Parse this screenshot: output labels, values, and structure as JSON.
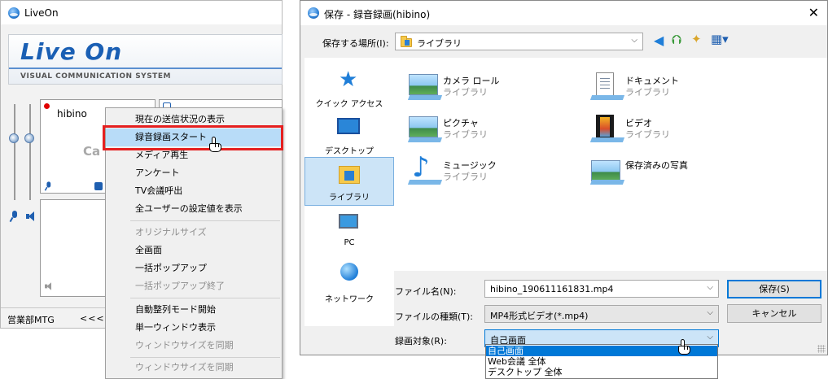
{
  "liveon": {
    "title": "LiveOn",
    "logo_text": "Live On",
    "logo_sub": "VISUAL COMMUNICATION SYSTEM",
    "panel_user": "hibino",
    "panel_cam_text": "Ca",
    "status_left": "営業部MTG",
    "status_arrows": "<<<<"
  },
  "context_menu": {
    "items": [
      {
        "label": "現在の送信状況の表示",
        "enabled": true
      },
      {
        "label": "録音録画スタート",
        "enabled": true,
        "highlighted": true
      },
      {
        "label": "メディア再生",
        "enabled": true
      },
      {
        "label": "アンケート",
        "enabled": true
      },
      {
        "label": "TV会議呼出",
        "enabled": true
      },
      {
        "label": "全ユーザーの設定値を表示",
        "enabled": true
      },
      {
        "label": "オリジナルサイズ",
        "enabled": false
      },
      {
        "label": "全画面",
        "enabled": true
      },
      {
        "label": "一括ポップアップ",
        "enabled": true
      },
      {
        "label": "一括ポップアップ終了",
        "enabled": false
      },
      {
        "label": "自動整列モード開始",
        "enabled": true
      },
      {
        "label": "単一ウィンドウ表示",
        "enabled": true
      },
      {
        "label": "ウィンドウサイズを同期",
        "enabled": false
      },
      {
        "label": "ウィンドウサイズを同期",
        "enabled": false
      }
    ]
  },
  "save_dialog": {
    "title": "保存 - 録音録画(hibino)",
    "location_label": "保存する場所(I):",
    "location_value": "ライブラリ",
    "nav": [
      {
        "label": "クイック アクセス",
        "icon": "star-icon"
      },
      {
        "label": "デスクトップ",
        "icon": "desktop-icon"
      },
      {
        "label": "ライブラリ",
        "icon": "library-icon",
        "selected": true
      },
      {
        "label": "PC",
        "icon": "pc-icon"
      },
      {
        "label": "ネットワーク",
        "icon": "network-icon"
      }
    ],
    "files": [
      {
        "name": "カメラ ロール",
        "type": "ライブラリ",
        "icon": "pictures-icon"
      },
      {
        "name": "ドキュメント",
        "type": "ライブラリ",
        "icon": "documents-icon"
      },
      {
        "name": "ピクチャ",
        "type": "ライブラリ",
        "icon": "pictures-icon"
      },
      {
        "name": "ビデオ",
        "type": "ライブラリ",
        "icon": "video-icon"
      },
      {
        "name": "ミュージック",
        "type": "ライブラリ",
        "icon": "music-icon"
      },
      {
        "name": "保存済みの写真",
        "type": "",
        "icon": "pictures-icon"
      }
    ],
    "filename_label": "ファイル名(N):",
    "filename_value": "hibino_190611161831.mp4",
    "filetype_label": "ファイルの種類(T):",
    "filetype_value": "MP4形式ビデオ(*.mp4)",
    "target_label": "録画対象(R):",
    "target_value": "自己画面",
    "target_options": [
      "自己画面",
      "Web会議 全体",
      "デスクトップ 全体"
    ],
    "save_button": "保存(S)",
    "cancel_button": "キャンセル"
  }
}
